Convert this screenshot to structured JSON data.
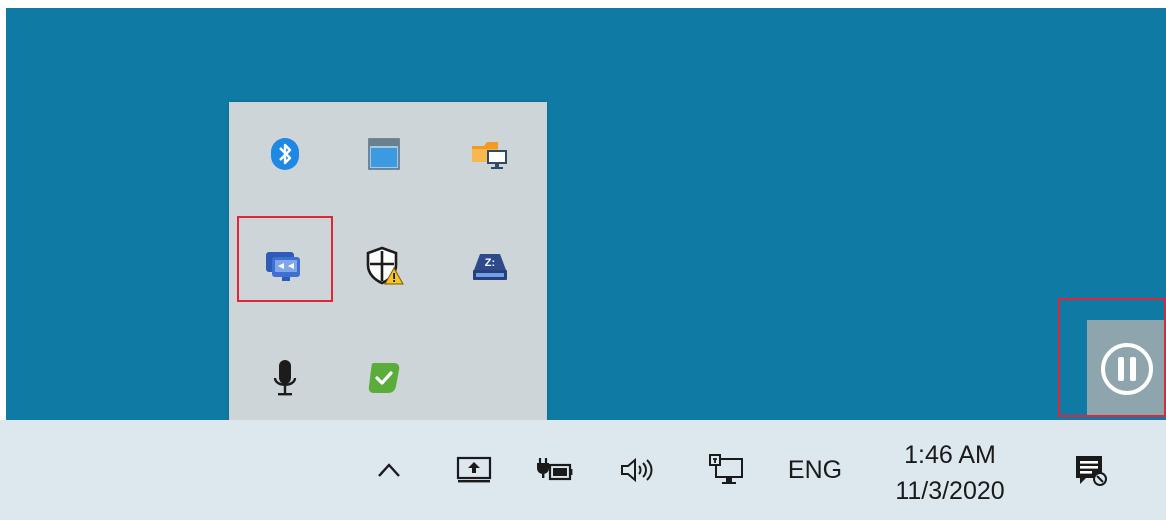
{
  "tray_overflow": {
    "icons": [
      {
        "name": "bluetooth-icon"
      },
      {
        "name": "window-app-icon"
      },
      {
        "name": "folder-network-icon"
      },
      {
        "name": "remote-desktop-icon"
      },
      {
        "name": "security-warning-icon"
      },
      {
        "name": "network-drive-icon"
      },
      {
        "name": "microphone-icon"
      },
      {
        "name": "green-check-icon"
      }
    ]
  },
  "taskbar": {
    "show_hidden_icon": "chevron-up-icon",
    "language": "ENG",
    "time": "1:46 AM",
    "date": "11/3/2020"
  },
  "colors": {
    "desktop": "#0f7aa3",
    "panel": "#cdd5d8",
    "taskbar": "#dde7ee",
    "highlight": "#e0263a",
    "bluetooth": "#1e88e5",
    "green_check": "#5aad3a"
  }
}
